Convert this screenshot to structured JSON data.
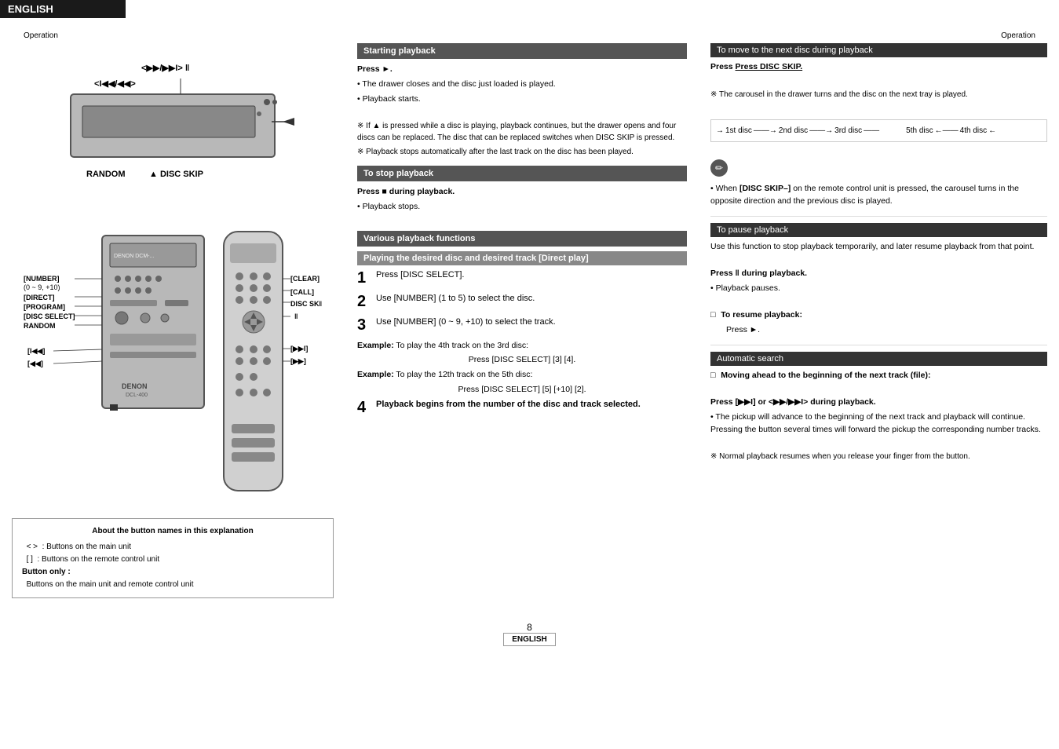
{
  "header": {
    "title": "ENGLISH"
  },
  "op_labels": {
    "left": "Operation",
    "right": "Operation"
  },
  "page_number": "8",
  "page_label": "ENGLISH",
  "diagram": {
    "top_labels": {
      "controls": "<▶▶/▶▶I>  ‖",
      "prev": "<I◀◀/◀◀>",
      "random": "RANDOM",
      "disc_skip_top": "▲  DISC SKIP"
    },
    "side_labels": [
      "[NUMBER]",
      "(0 ~ 9, +10)",
      "[DIRECT]",
      "[PROGRAM]",
      "[DISC SELECT]",
      "RANDOM",
      "[I◀◀]",
      "[◀◀]",
      "[CLEAR]",
      "[CALL]",
      "DISC SKIP",
      "‖",
      "[▶▶I]",
      "[▶▶]"
    ]
  },
  "about_box": {
    "title": "About the button names in this explanation",
    "line1_left": "<    >",
    "line1_right": ": Buttons on the main unit",
    "line2_left": "[      ]",
    "line2_right": ": Buttons on the remote control unit",
    "line3": "Button only :",
    "line4": "Buttons on the main unit and remote control unit"
  },
  "starting_playback": {
    "section_title": "Starting playback",
    "press_label": "Press ►.",
    "bullet1": "The drawer closes and the disc just loaded is played.",
    "bullet2": "Playback starts.",
    "note1": "If ▲ is pressed while a disc is playing, playback continues, but the drawer opens and four discs can be replaced. The disc that can be replaced switches when DISC SKIP is pressed.",
    "note2": "Playback stops automatically after the last track on the disc has been played."
  },
  "stop_playback": {
    "section_title": "To stop playback",
    "press_label": "Press ■ during playback.",
    "bullet1": "Playback stops."
  },
  "various_functions": {
    "section_title": "Various playback functions",
    "sub_title": "Playing the desired disc and desired track [Direct play]",
    "step1": "Press [DISC SELECT].",
    "step2": "Use [NUMBER] (1 to 5) to select the disc.",
    "step3": "Use [NUMBER] (0 ~ 9, +10) to select the track.",
    "example1_label": "Example:",
    "example1_text": "To play the 4th track on the 3rd disc:",
    "example1_detail": "Press [DISC SELECT] [3] [4].",
    "example2_label": "Example:",
    "example2_text": "To play the 12th track on the 5th disc:",
    "example2_detail": "Press [DISC SELECT] [5] [+10] [2].",
    "step4": "Playback begins from the number of the disc and track selected."
  },
  "next_disc": {
    "section_title": "To move to the next disc during playback",
    "press_label": "Press DISC SKIP.",
    "note1": "The carousel in the drawer turns and the disc on the next tray is played.",
    "disc_flow": {
      "disc1": "1st disc",
      "disc2": "2nd disc",
      "disc3": "3rd disc",
      "disc4": "4th disc",
      "disc5": "5th disc"
    },
    "note2_prefix": "When",
    "note2_key": "[DISC SKIP–]",
    "note2_text": "on the remote control unit is pressed, the carousel turns in the opposite direction and the previous disc is played."
  },
  "pause_playback": {
    "section_title": "To pause playback",
    "description": "Use this function to stop playback temporarily, and later resume playback from that point.",
    "press_label": "Press ‖ during playback.",
    "bullet1": "Playback pauses.",
    "resume_label": "To resume playback:",
    "resume_text": "Press ►."
  },
  "auto_search": {
    "section_title": "Automatic search",
    "sub_title": "Moving ahead to the beginning of the next track (file):",
    "press_label": "Press [▶▶I] or <▶▶/▶▶I> during playback.",
    "bullet1": "The pickup will advance to the beginning of the next track and playback will continue. Pressing the button several times will forward the pickup the corresponding number tracks.",
    "note1": "Normal playback resumes when you release your finger from the button."
  }
}
